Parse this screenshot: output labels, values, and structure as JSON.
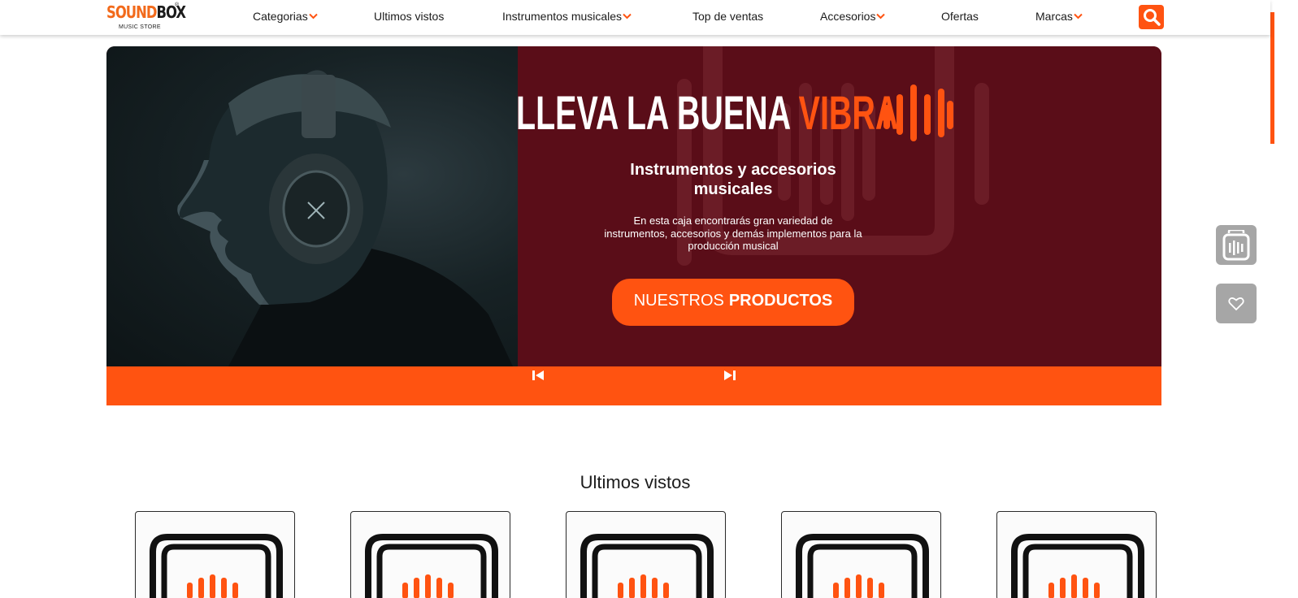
{
  "brand": {
    "name_part1": "SOUND",
    "name_part2": "BOX",
    "registered": "®",
    "tagline": "MUSIC STORE"
  },
  "nav": {
    "items": [
      {
        "label": "Categorias",
        "has_dropdown": true
      },
      {
        "label": "Ultimos vistos",
        "has_dropdown": false
      },
      {
        "label": "Instrumentos musicales",
        "has_dropdown": true
      },
      {
        "label": "Top de ventas",
        "has_dropdown": false
      },
      {
        "label": "Accesorios",
        "has_dropdown": true
      },
      {
        "label": "Ofertas",
        "has_dropdown": false
      },
      {
        "label": "Marcas",
        "has_dropdown": true
      }
    ],
    "search_icon": "search-icon"
  },
  "hero": {
    "title_white": "LLEVA LA BUENA",
    "title_accent": "VIBRA",
    "subtitle": "Instrumentos y accesorios musicales",
    "description": "En esta caja encontrarás gran variedad de instrumentos, accesorios y demás implementos para la producción musical",
    "cta_light": "NUESTROS",
    "cta_bold": "PRODUCTOS",
    "prev_icon": "skip-previous-icon",
    "next_icon": "skip-next-icon"
  },
  "floating": {
    "cart_icon": "cart-box-icon",
    "favorites_icon": "heart-icon"
  },
  "section": {
    "title": "Ultimos vistos",
    "card_icon": "soundbox-logo-icon",
    "card_count": 5
  },
  "colors": {
    "accent": "#ff5311",
    "hero_bg": "#5a0d18",
    "floating_gray": "#a6a6a6"
  }
}
